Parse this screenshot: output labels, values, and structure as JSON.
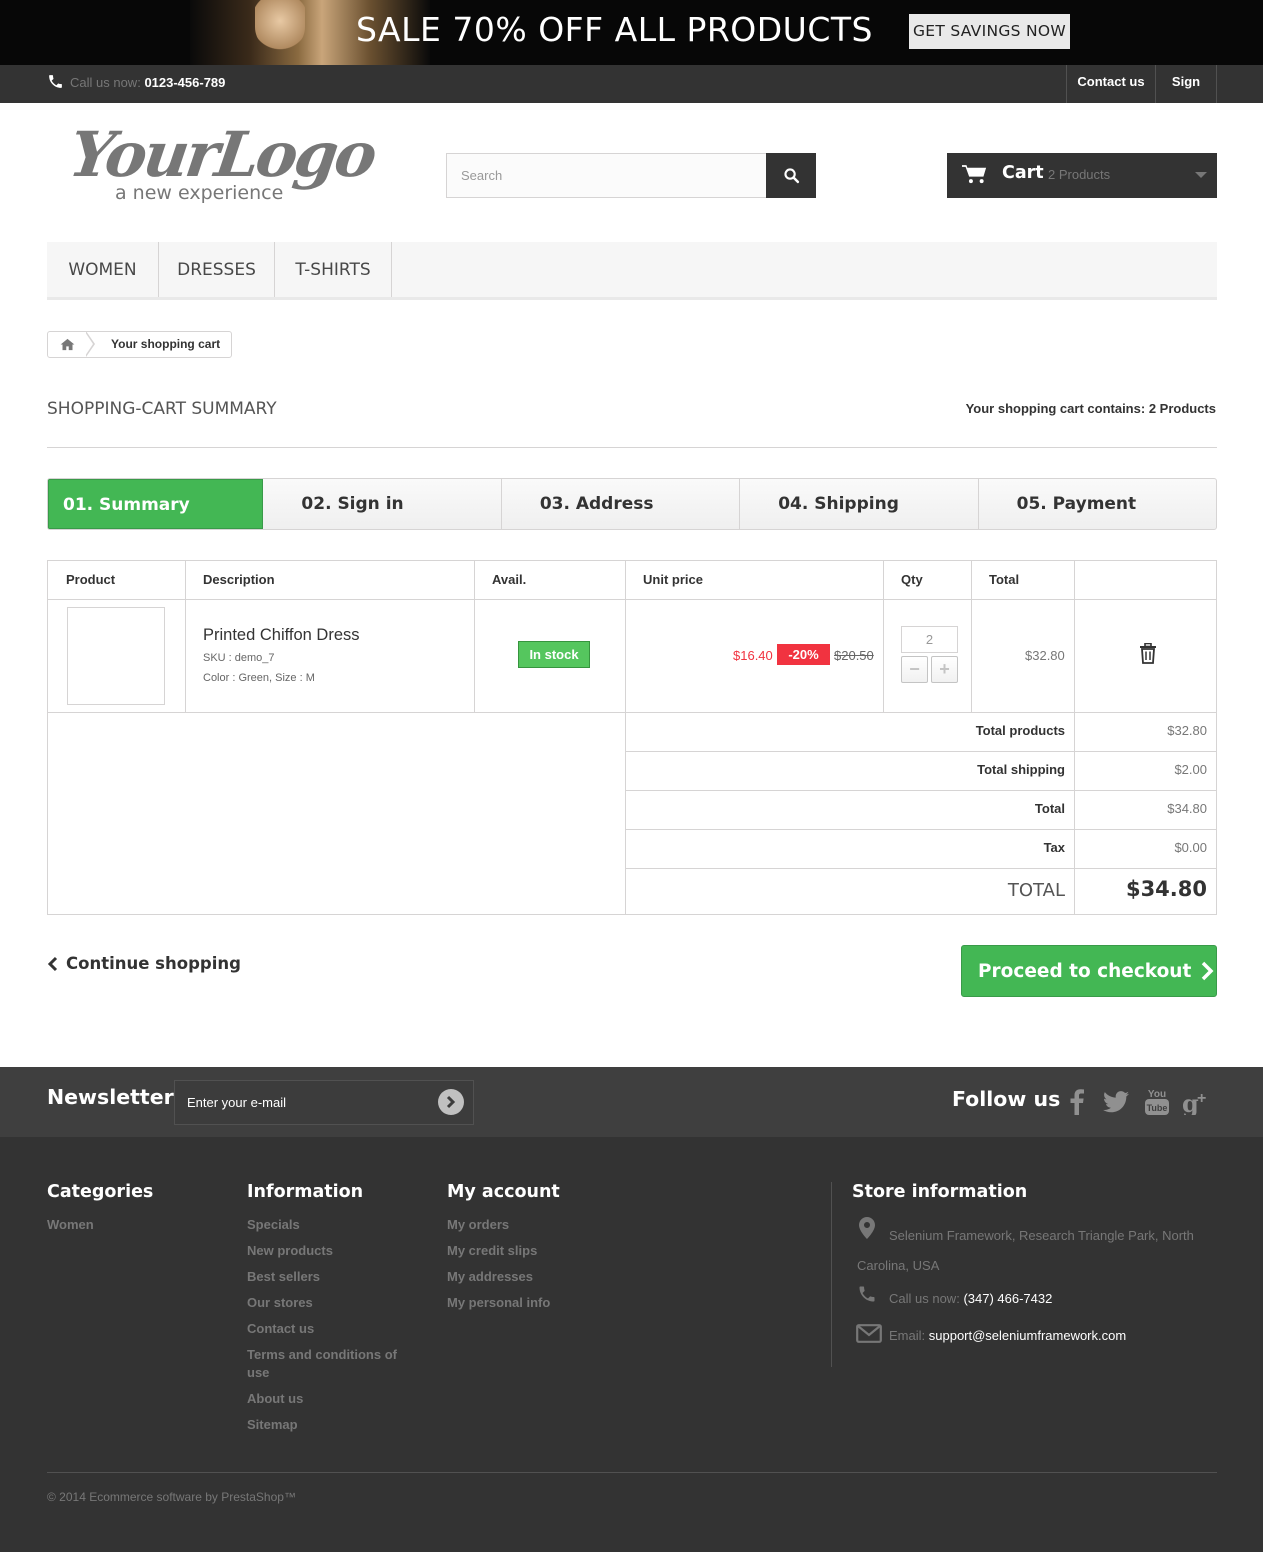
{
  "banner": {
    "title": "SALE 70% OFF ALL PRODUCTS",
    "button": "GET SAVINGS NOW"
  },
  "topbar": {
    "call_label": "Call us now:",
    "phone": "0123-456-789",
    "contact": "Contact us",
    "signin": "Sign in"
  },
  "header": {
    "logo_script": "YourLogo",
    "logo_tagline": "a new experience",
    "search_placeholder": "Search",
    "cart_label": "Cart",
    "cart_count": "2 Products"
  },
  "menu": [
    "WOMEN",
    "DRESSES",
    "T-SHIRTS"
  ],
  "breadcrumb": {
    "current": "Your shopping cart"
  },
  "page": {
    "title": "SHOPPING-CART SUMMARY",
    "contains_label": "Your shopping cart contains:",
    "contains_value": "2 Products"
  },
  "steps": [
    "01. Summary",
    "02. Sign in",
    "03. Address",
    "04. Shipping",
    "05. Payment"
  ],
  "table": {
    "headers": [
      "Product",
      "Description",
      "Avail.",
      "Unit price",
      "Qty",
      "Total"
    ],
    "item": {
      "name": "Printed Chiffon Dress",
      "sku": "SKU : demo_7",
      "attributes": "Color : Green, Size : M",
      "availability": "In stock",
      "price": "$16.40",
      "reduction": "-20%",
      "old_price": "$20.50",
      "qty": "2",
      "total": "$32.80"
    },
    "summary": [
      {
        "label": "Total products",
        "value": "$32.80"
      },
      {
        "label": "Total shipping",
        "value": "$2.00"
      },
      {
        "label": "Total",
        "value": "$34.80"
      },
      {
        "label": "Tax",
        "value": "$0.00"
      }
    ],
    "grand_total": {
      "label": "TOTAL",
      "value": "$34.80"
    }
  },
  "actions": {
    "continue": "Continue shopping",
    "checkout": "Proceed to checkout"
  },
  "newsletter": {
    "title": "Newsletter",
    "placeholder": "Enter your e-mail",
    "follow": "Follow us"
  },
  "footer": {
    "categories": {
      "title": "Categories",
      "links": [
        "Women"
      ]
    },
    "information": {
      "title": "Information",
      "links": [
        "Specials",
        "New products",
        "Best sellers",
        "Our stores",
        "Contact us",
        "Terms and conditions of use",
        "About us",
        "Sitemap"
      ]
    },
    "account": {
      "title": "My account",
      "links": [
        "My orders",
        "My credit slips",
        "My addresses",
        "My personal info"
      ]
    },
    "store": {
      "title": "Store information",
      "address": "Selenium Framework, Research Triangle Park, North Carolina, USA",
      "call_label": "Call us now:",
      "phone": "(347) 466-7432",
      "email_label": "Email:",
      "email": "support@seleniumframework.com"
    },
    "copyright": "© 2014 Ecommerce software by PrestaShop™"
  },
  "colors": {
    "accent_green": "#43b754",
    "sale_red": "#f13340",
    "dark": "#333333"
  }
}
